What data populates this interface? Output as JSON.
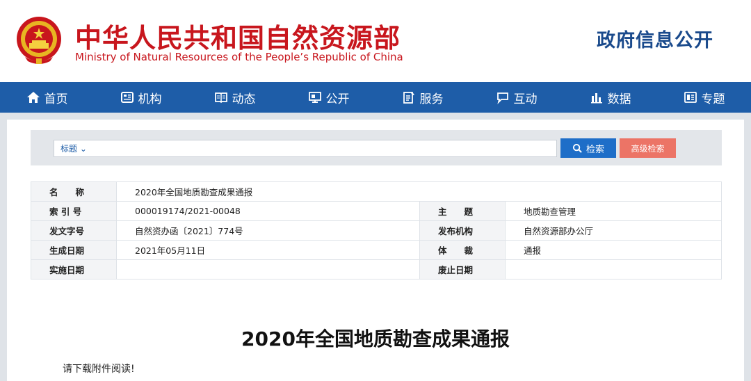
{
  "header": {
    "title_cn": "中华人民共和国自然资源部",
    "title_en": "Ministry of Natural Resources of the People’s Republic of China",
    "section": "政府信息公开"
  },
  "nav": {
    "items": [
      {
        "label": "首页",
        "icon": "home-icon"
      },
      {
        "label": "机构",
        "icon": "org-icon"
      },
      {
        "label": "动态",
        "icon": "book-icon"
      },
      {
        "label": "公开",
        "icon": "monitor-icon"
      },
      {
        "label": "服务",
        "icon": "document-edit-icon"
      },
      {
        "label": "互动",
        "icon": "chat-icon"
      },
      {
        "label": "数据",
        "icon": "bar-chart-icon"
      },
      {
        "label": "专题",
        "icon": "topic-icon"
      }
    ]
  },
  "search": {
    "select_label": "标题",
    "value": "",
    "search_button": "检索",
    "advanced_button": "高级检索"
  },
  "meta": {
    "name_label": "名　　称",
    "name_value": "2020年全国地质勘查成果通报",
    "index_label": "索 引 号",
    "index_value": "000019174/2021-00048",
    "subject_label": "主　　题",
    "subject_value": "地质勘查管理",
    "docno_label": "发文字号",
    "docno_value": "自然资办函〔2021〕774号",
    "publisher_label": "发布机构",
    "publisher_value": "自然资源部办公厅",
    "date_label": "生成日期",
    "date_value": "2021年05月11日",
    "genre_label": "体　　裁",
    "genre_value": "通报",
    "effective_label": "实施日期",
    "effective_value": "",
    "expire_label": "废止日期",
    "expire_value": ""
  },
  "doc": {
    "title": "2020年全国地质勘查成果通报",
    "body": "请下载附件阅读!"
  },
  "colors": {
    "brand_red": "#c8161d",
    "nav_blue": "#1e5da8",
    "search_blue": "#1e6ec8",
    "advanced_red": "#ec7466"
  }
}
